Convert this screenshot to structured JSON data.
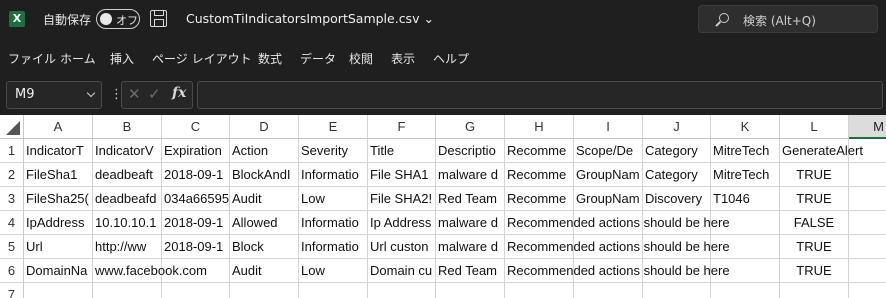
{
  "titlebar": {
    "app_icon": "excel-icon",
    "autosave_label": "自動保存",
    "toggle_state": "オフ",
    "save_icon": "save-icon",
    "filename": "CustomTiIndicatorsImportSample.csv ⌄",
    "search_placeholder": "検索 (Alt+Q)"
  },
  "menu": [
    "ファイル",
    "ホーム",
    "挿入",
    "ページ レイアウト",
    "数式",
    "データ",
    "校閲",
    "表示",
    "ヘルプ"
  ],
  "formula_bar": {
    "name_box": "M9",
    "cancel_icon": "✕",
    "enter_icon": "✓",
    "fx_label": "fx",
    "formula": ""
  },
  "grid": {
    "columns": [
      "A",
      "B",
      "C",
      "D",
      "E",
      "F",
      "G",
      "H",
      "I",
      "J",
      "K",
      "L",
      "M"
    ],
    "selected_column": "M",
    "rows": [
      "1",
      "2",
      "3",
      "4",
      "5",
      "6",
      "7"
    ],
    "cells": [
      [
        "IndicatorT",
        "IndicatorV",
        "Expiration",
        "Action",
        "Severity",
        "Title",
        "Descriptio",
        "Recomme",
        "Scope/De",
        "Category",
        "MitreTech",
        "GenerateAlert",
        ""
      ],
      [
        "FileSha1",
        "deadbeaft",
        "2018-09-1",
        "BlockAndI",
        "Informatio",
        "File SHA1",
        "malware d",
        "Recomme",
        "GroupNam",
        "Category",
        "MitreTech",
        "TRUE",
        ""
      ],
      [
        "FileSha25(",
        "deadbeafd",
        "034a66595",
        "Audit",
        "Low",
        "File SHA2!",
        "Red Team",
        "Recomme",
        "GroupNam",
        "Discovery",
        "T1046",
        "TRUE",
        ""
      ],
      [
        "IpAddress",
        "10.10.10.1",
        "2018-09-1",
        "Allowed",
        "Informatio",
        "Ip Address",
        "malware d",
        "Recommended actions should be here",
        "",
        "",
        "",
        "FALSE",
        ""
      ],
      [
        "Url",
        "http://ww",
        "2018-09-1",
        "Block",
        "Informatio",
        "Url custon",
        "malware d",
        "Recommended actions should be here",
        "",
        "",
        "",
        "TRUE",
        ""
      ],
      [
        "DomainNa",
        "www.facebook.com",
        "",
        "Audit",
        "Low",
        "Domain cu",
        "Red Team",
        "Recommended actions should be here",
        "",
        "",
        "",
        "TRUE",
        ""
      ],
      [
        "",
        "",
        "",
        "",
        "",
        "",
        "",
        "",
        "",
        "",
        "",
        "",
        ""
      ]
    ]
  }
}
